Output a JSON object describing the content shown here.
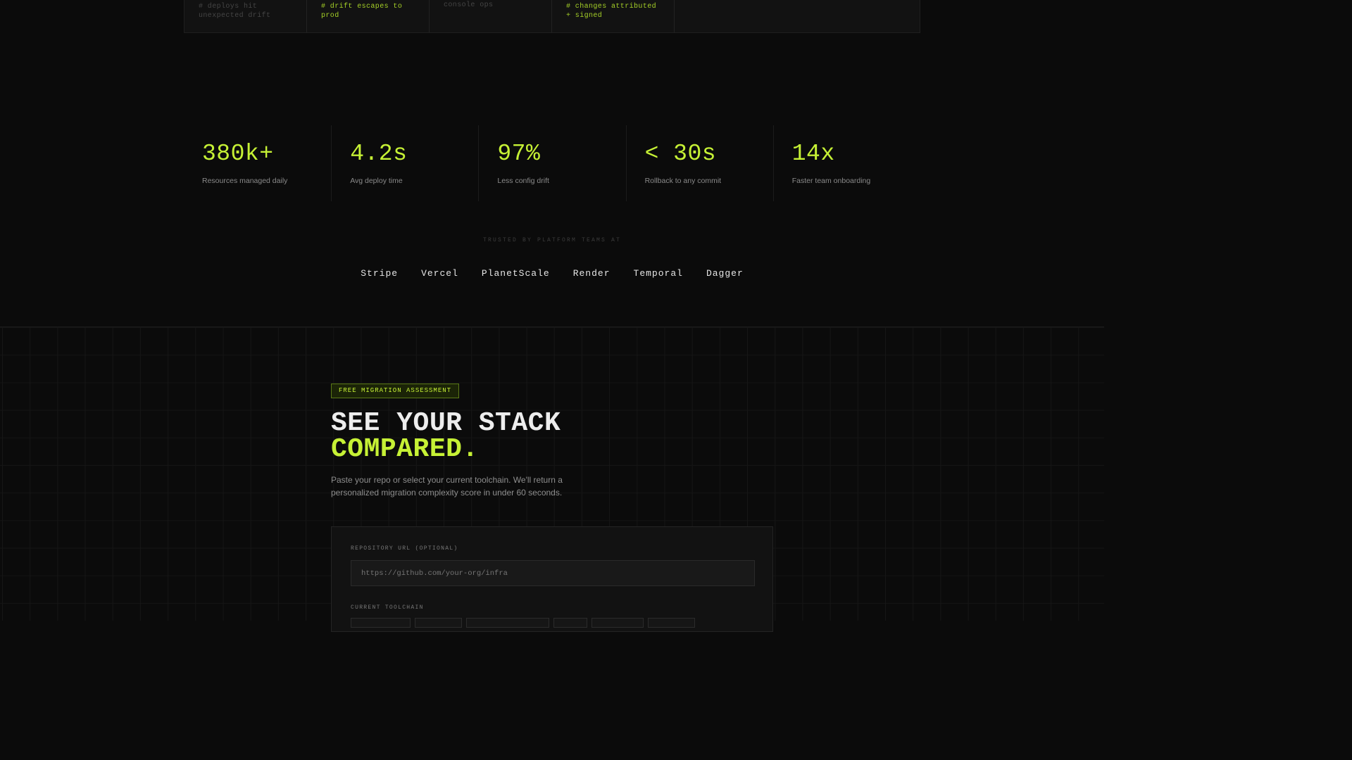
{
  "comparison_strip": {
    "cells": [
      {
        "text": "# deploys hit unexpected drift",
        "style": "dim"
      },
      {
        "text": "# drift escapes to prod",
        "style": "lime"
      },
      {
        "text": "console ops",
        "style": "dim"
      },
      {
        "text": "# changes attributed + signed",
        "style": "lime"
      }
    ]
  },
  "stats": [
    {
      "value": "380k+",
      "label": "Resources managed daily"
    },
    {
      "value": "4.2s",
      "label": "Avg deploy time"
    },
    {
      "value": "97%",
      "label": "Less config drift"
    },
    {
      "value": "< 30s",
      "label": "Rollback to any commit"
    },
    {
      "value": "14x",
      "label": "Faster team onboarding"
    }
  ],
  "trusted": {
    "heading": "TRUSTED BY PLATFORM TEAMS AT",
    "logos": [
      "Stripe",
      "Vercel",
      "PlanetScale",
      "Render",
      "Temporal",
      "Dagger"
    ]
  },
  "assessment": {
    "badge": "FREE MIGRATION ASSESSMENT",
    "title_line1": "SEE YOUR STACK",
    "title_line2": "COMPARED.",
    "subtitle": "Paste your repo or select your current toolchain. We'll return a personalized migration complexity score in under 60 seconds.",
    "repo_label": "REPOSITORY URL (OPTIONAL)",
    "repo_placeholder": "https://github.com/your-org/infra",
    "toolchain_label": "CURRENT TOOLCHAIN"
  },
  "colors": {
    "accent": "#c6f135",
    "background": "#0b0b0b",
    "panel": "#121212",
    "muted_text": "#8a8a8a"
  }
}
